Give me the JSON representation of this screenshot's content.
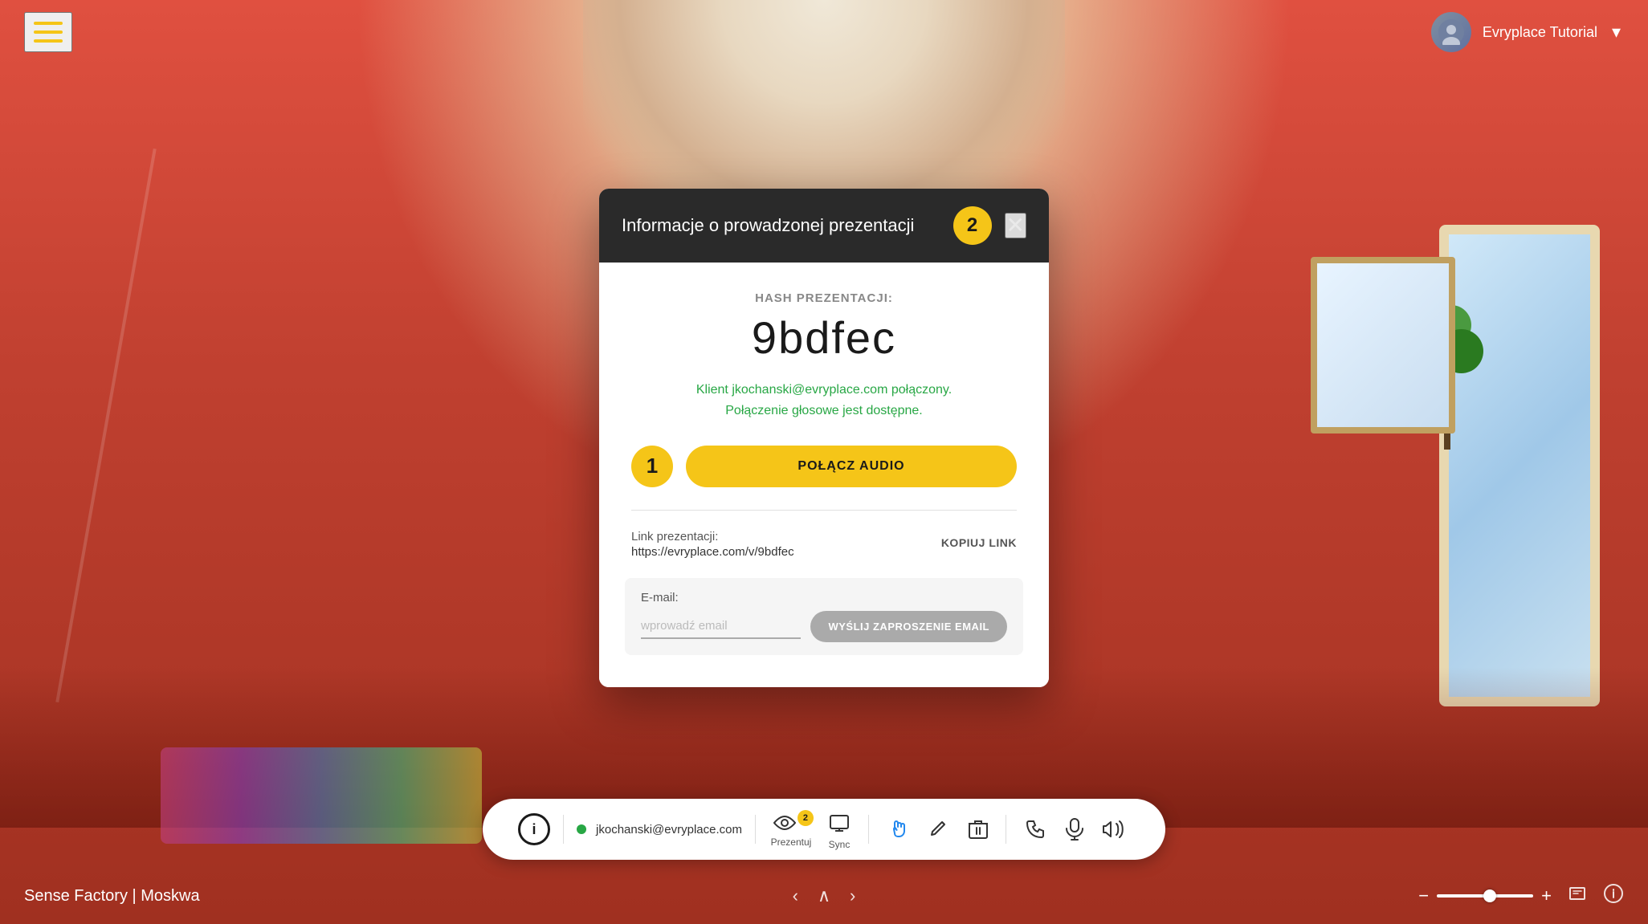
{
  "app": {
    "title": "Sense Factory | Moskwa",
    "background_color": "#c04030"
  },
  "top_nav": {
    "hamburger_label": "menu",
    "tour_name": "Evryplace Tutorial",
    "dropdown_label": "expand"
  },
  "modal": {
    "title": "Informacje o prowadzonej prezentacji",
    "step_badge": "2",
    "close_label": "✕",
    "hash_label": "HASH PREZENTACJI:",
    "hash_value": "9bdfec",
    "connection_status_line1": "Klient jkochanski@evryplace.com połączony.",
    "connection_status_line2": "Połączenie głosowe jest dostępne.",
    "audio_step_badge": "1",
    "audio_button_label": "POŁĄCZ AUDIO",
    "link_section": {
      "label": "Link prezentacji:",
      "url": "https://evryplace.com/v/9bdfec",
      "copy_button_label": "KOPIUJ LINK"
    },
    "email_section": {
      "label": "E-mail:",
      "placeholder": "wprowadź email",
      "send_button_label": "WYŚLIJ ZAPROSZENIE EMAIL"
    }
  },
  "toolbar": {
    "info_button_label": "ⓘ",
    "user_email": "jkochanski@evryplace.com",
    "present_label": "Prezentuj",
    "sync_label": "Sync",
    "hand_label": "hand",
    "pencil_label": "pencil",
    "trash_label": "trash",
    "phone_label": "phone",
    "mic_label": "microphone",
    "volume_label": "volume"
  },
  "bottom_bar": {
    "title": "Sense Factory | Moskwa",
    "zoom_minus": "−",
    "zoom_plus": "+"
  }
}
